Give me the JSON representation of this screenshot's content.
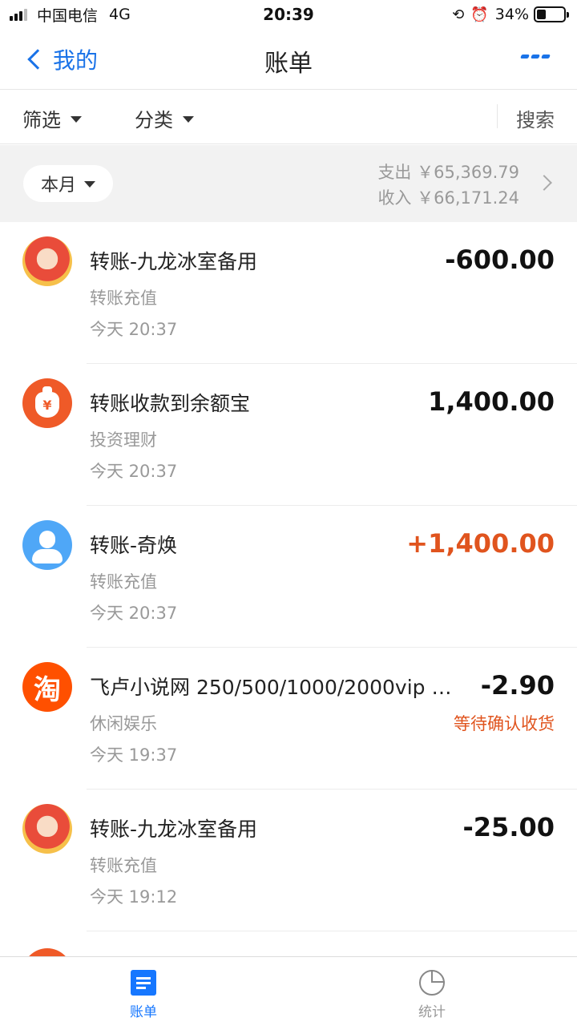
{
  "status_bar": {
    "carrier": "中国电信",
    "network": "4G",
    "time": "20:39",
    "battery": "34%",
    "battery_level": 0.34
  },
  "nav": {
    "back_label": "我的",
    "title": "账单"
  },
  "filters": {
    "filter_label": "筛选",
    "category_label": "分类",
    "search_label": "搜索"
  },
  "summary": {
    "month_label": "本月",
    "expense": "支出 ￥65,369.79",
    "income": "收入 ￥66,171.24"
  },
  "transactions": [
    {
      "title": "转账-九龙冰室备用",
      "category": "转账充值",
      "time": "今天  20:37",
      "amount": "-600.00",
      "status": "",
      "avatar": "fortune-god-avatar"
    },
    {
      "title": "转账收款到余额宝",
      "category": "投资理财",
      "time": "今天  20:37",
      "amount": "1,400.00",
      "status": "",
      "avatar": "yuebao-bag-icon"
    },
    {
      "title": "转账-奇焕",
      "category": "转账充值",
      "time": "今天  20:37",
      "amount": "+1,400.00",
      "status": "",
      "avatar": "default-user-avatar"
    },
    {
      "title": "飞卢小说网 250/500/1000/2000vip 点...",
      "category": "休闲娱乐",
      "time": "今天  19:37",
      "amount": "-2.90",
      "status": "等待确认收货",
      "avatar": "taobao-icon"
    },
    {
      "title": "转账-九龙冰室备用",
      "category": "转账充值",
      "time": "今天  19:12",
      "amount": "-25.00",
      "status": "",
      "avatar": "fortune-god-avatar"
    }
  ],
  "taobao_glyph": "淘",
  "yuebao_glyph": "¥",
  "tabs": {
    "bill": "账单",
    "stats": "统计"
  },
  "colors": {
    "accent": "#1677ff",
    "income": "#e0541e",
    "summary_bg": "#f2f2f2"
  }
}
